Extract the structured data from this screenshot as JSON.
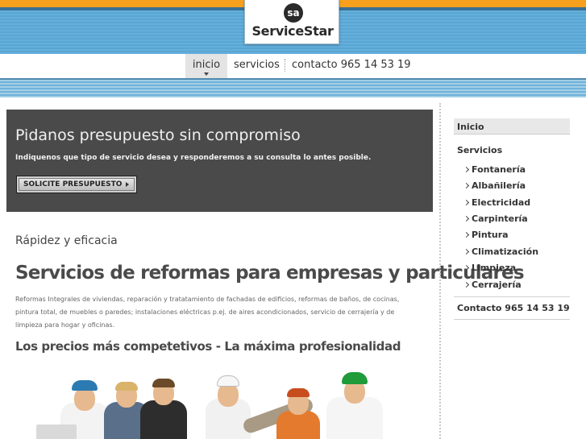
{
  "logo": {
    "mark": "sa",
    "brand": "ServiceStar"
  },
  "nav": {
    "items": [
      "inicio",
      "servicios",
      "contacto 965 14 53 19"
    ]
  },
  "hero": {
    "title": "Pidanos presupuesto sin compromiso",
    "text": "Indiquenos que tipo de servicio desea y responderemos a su consulta lo antes posible.",
    "button": "SOLICITE PRESUPUESTO"
  },
  "main": {
    "subtitle": "Rápidez y eficacia",
    "heading": "Servicios de reformas para empresas y particulares",
    "paragraph": "Reformas Integrales de viviendas, reparación y tratatamiento de fachadas de edificios, reformas de baños, de cocinas, pintura total, de muebles o paredes; instalaciones eléctricas p.ej. de aires acondicionados, servicio de cerrajería y de limpieza para hogar y oficinas.",
    "tagline": "Los precios más competetivos - La máxima profesionalidad"
  },
  "sidebar": {
    "home": "Inicio",
    "services": "Servicios",
    "items": [
      "Fontanería",
      "Albañilería",
      "Electricidad",
      "Carpintería",
      "Pintura",
      "Climatización",
      "Limpieza",
      "Cerrajería"
    ],
    "contact": "Contacto 965 14 53 19"
  },
  "colors": {
    "header_blue": "#5eaad6",
    "orange": "#f6a01e",
    "hero_bg": "#4a4a4a"
  }
}
